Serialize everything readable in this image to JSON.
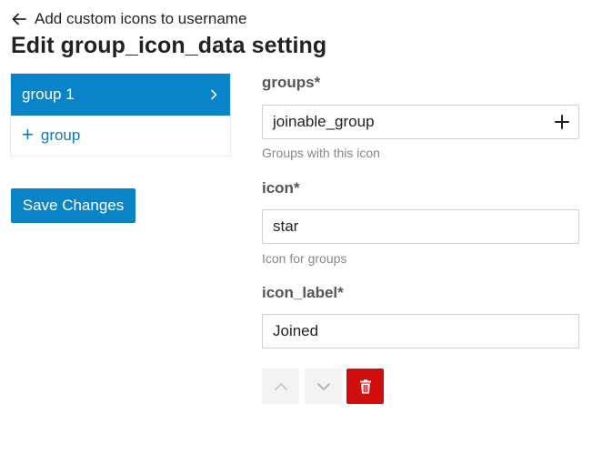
{
  "header": {
    "back_label": "Add custom icons to username",
    "title": "Edit group_icon_data setting"
  },
  "sidebar": {
    "active_group_label": "group 1",
    "add_group_label": "group"
  },
  "actions": {
    "save_label": "Save Changes"
  },
  "fields": {
    "groups": {
      "label": "groups*",
      "value": "joinable_group",
      "help": "Groups with this icon"
    },
    "icon": {
      "label": "icon*",
      "value": "star",
      "help": "Icon for groups"
    },
    "icon_label": {
      "label": "icon_label*",
      "value": "Joined"
    }
  },
  "colors": {
    "accent": "#0a84c8",
    "danger": "#d00e0e"
  },
  "icons": {
    "back": "arrow-left-icon",
    "chevron": "chevron-right-icon",
    "add": "plus-icon",
    "up": "chevron-up-icon",
    "down": "chevron-down-icon",
    "delete": "trash-icon"
  }
}
